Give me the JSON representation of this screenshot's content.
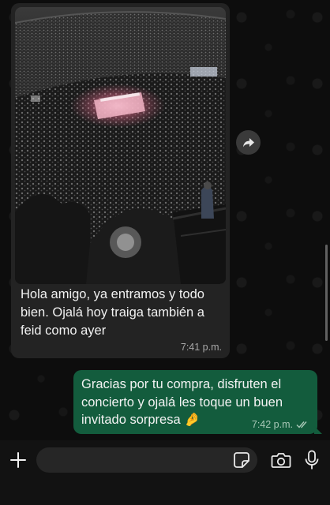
{
  "messages": {
    "incoming": {
      "text": "Hola amigo, ya entramos y todo bien. Ojalá hoy traiga también a feid como ayer",
      "time": "7:41 p.m."
    },
    "outgoing": {
      "text": "Gracias por tu compra, disfruten el concierto y ojalá les toque un buen invitado sorpresa 🤌",
      "time": "7:42 p.m.",
      "status_icon": "double-check-icon"
    }
  },
  "input": {
    "placeholder": ""
  },
  "icons": {
    "forward": "forward-icon",
    "plus": "plus-icon",
    "sticker": "sticker-icon",
    "camera": "camera-icon",
    "microphone": "microphone-icon"
  },
  "colors": {
    "background": "#0d0d0d",
    "incoming_bubble": "#232323",
    "outgoing_bubble": "#135c3d",
    "read_ticks": "#a8c8b7"
  }
}
